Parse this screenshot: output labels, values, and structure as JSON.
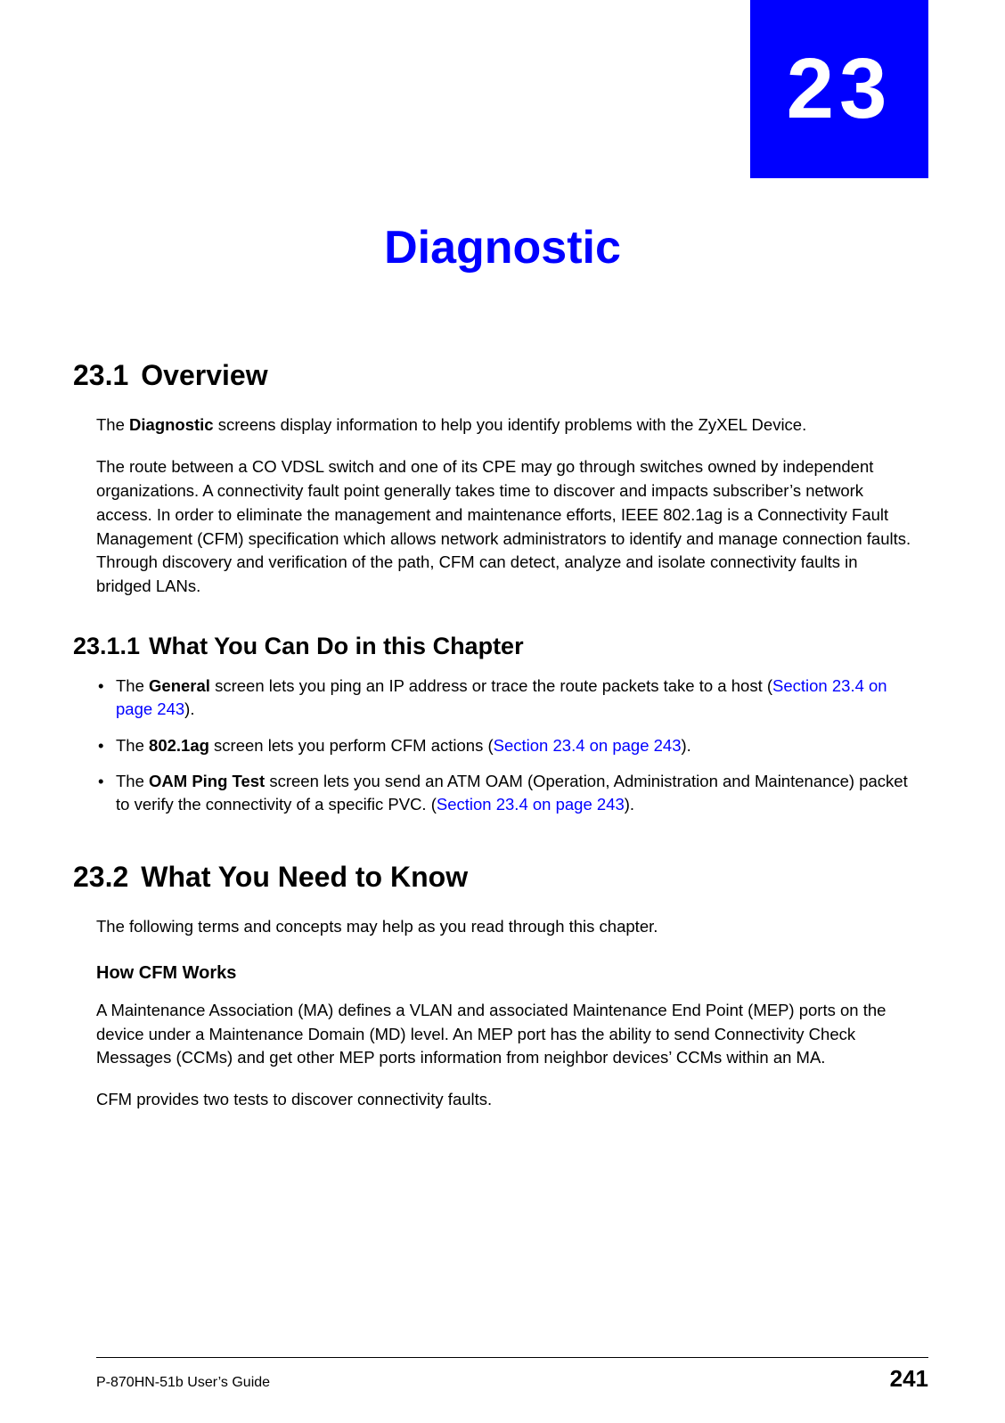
{
  "chapter": {
    "number": "23",
    "title": "Diagnostic"
  },
  "sections": {
    "s1": {
      "num": "23.1",
      "title": "Overview",
      "p1": "The ",
      "p1_bold": "Diagnostic",
      "p1_rest": " screens display information to help you identify problems with the ZyXEL Device.",
      "p2": "The route between a CO VDSL switch and one of its CPE may go through switches owned by independent organizations. A connectivity fault point generally takes time to discover and impacts subscriber’s network access. In order to eliminate the management and maintenance efforts, IEEE 802.1ag is a Connectivity Fault Management (CFM) specification which allows network administrators to identify and manage connection faults. Through discovery and verification of the path, CFM can detect, analyze and isolate connectivity faults in bridged LANs."
    },
    "s1_1": {
      "num": "23.1.1",
      "title": "What You Can Do in this Chapter",
      "bullets": [
        {
          "pre": "The ",
          "bold": "General",
          "mid": " screen lets you ping an IP address or trace the route packets take to a host (",
          "link": "Section 23.4 on page 243",
          "post": ")."
        },
        {
          "pre": "The ",
          "bold": "802.1ag",
          "mid": " screen lets you perform CFM actions (",
          "link": "Section 23.4 on page 243",
          "post": ")."
        },
        {
          "pre": "The ",
          "bold": "OAM Ping Test",
          "mid": " screen lets you send an ATM OAM (Operation, Administration and Maintenance) packet to verify the connectivity of a specific PVC. (",
          "link": "Section 23.4 on page 243",
          "post": ")."
        }
      ]
    },
    "s2": {
      "num": "23.2",
      "title": "What You Need to Know",
      "p1": "The following terms and concepts may help as you read through this chapter.",
      "h3": "How CFM Works",
      "p2": "A Maintenance Association (MA) defines a VLAN and associated Maintenance End Point (MEP) ports on the device under a Maintenance Domain (MD) level. An MEP port has the ability to send Connectivity Check Messages (CCMs) and get other MEP ports information from neighbor devices’ CCMs within an MA.",
      "p3": "CFM provides two tests to discover connectivity faults."
    }
  },
  "footer": {
    "guide": "P-870HN-51b User’s Guide",
    "page": "241"
  }
}
